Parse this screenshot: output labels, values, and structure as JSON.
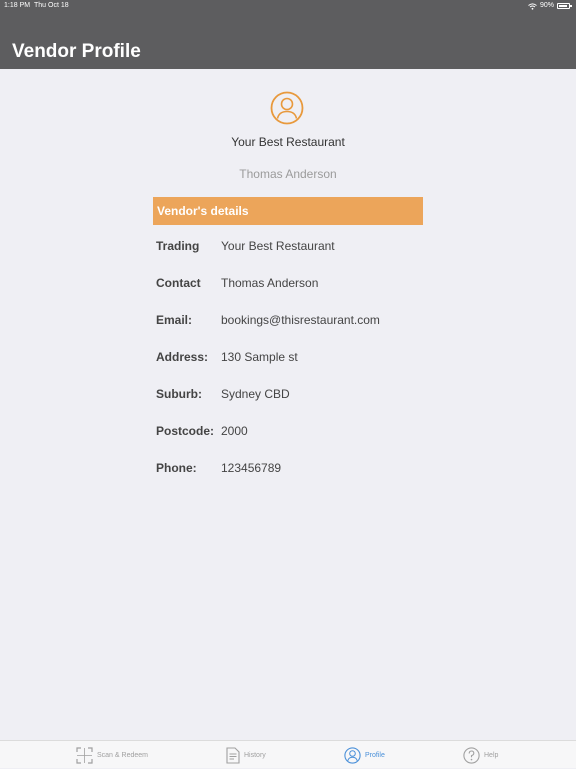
{
  "status_bar": {
    "time": "1:18 PM",
    "date": "Thu Oct 18",
    "battery": "90%"
  },
  "navbar": {
    "title": "Vendor Profile"
  },
  "profile": {
    "restaurant_name": "Your Best Restaurant",
    "owner_name": "Thomas Anderson",
    "avatar_icon": "user-circle-icon",
    "accent_color": "#e8993c"
  },
  "vendor_details": {
    "header": "Vendor's details",
    "header_color": "#eca55a",
    "rows": [
      {
        "label": "Trading",
        "value": "Your Best Restaurant"
      },
      {
        "label": "Contact",
        "value": "Thomas Anderson"
      },
      {
        "label": "Email:",
        "value": "bookings@thisrestaurant.com"
      },
      {
        "label": "Address:",
        "value": "130 Sample st"
      },
      {
        "label": "Suburb:",
        "value": "Sydney CBD"
      },
      {
        "label": "Postcode:",
        "value": "2000"
      },
      {
        "label": "Phone:",
        "value": "123456789"
      }
    ]
  },
  "tabbar": {
    "active_color": "#4a90d9",
    "tabs": [
      {
        "label": "Scan & Redeem",
        "icon": "scan-icon",
        "active": false
      },
      {
        "label": "History",
        "icon": "document-icon",
        "active": false
      },
      {
        "label": "Profile",
        "icon": "profile-icon",
        "active": true
      },
      {
        "label": "Help",
        "icon": "help-icon",
        "active": false
      }
    ]
  }
}
